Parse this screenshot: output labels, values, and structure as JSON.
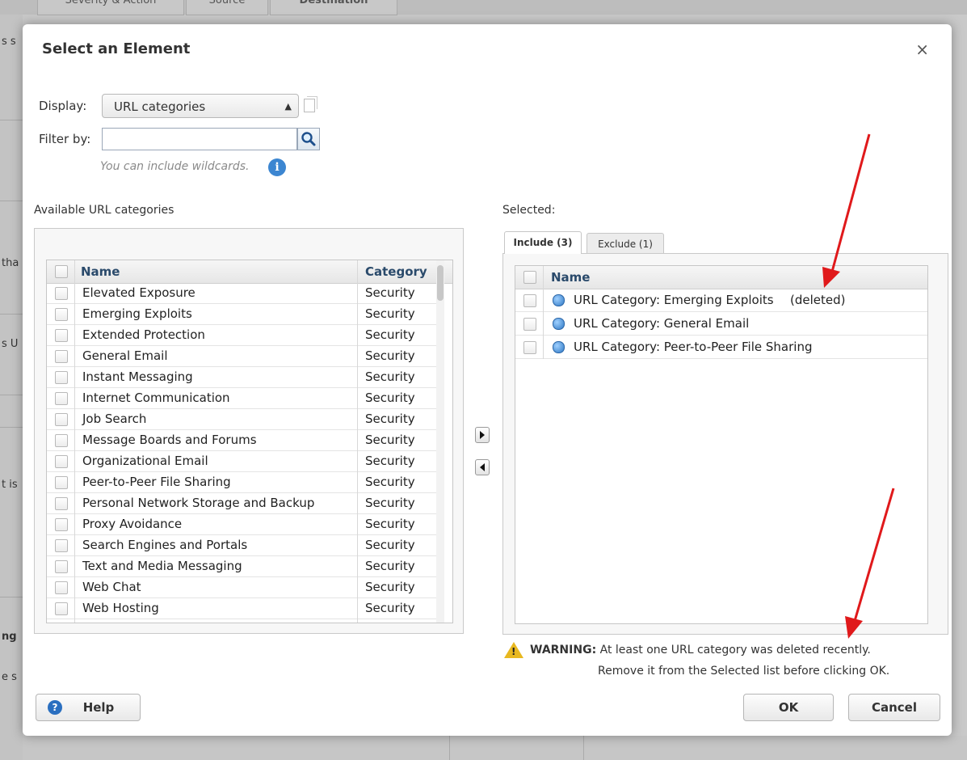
{
  "background": {
    "tabs": [
      "Severity & Action",
      "Source",
      "Destination"
    ],
    "left_fragments": [
      "s s",
      "tha",
      "s U",
      "t is",
      "ng",
      "e s"
    ]
  },
  "dialog": {
    "title": "Select an Element",
    "close_label": "×",
    "display_label": "Display:",
    "display_value": "URL categories",
    "filter_label": "Filter by:",
    "filter_value": "",
    "filter_placeholder": "",
    "hint": "You can include wildcards.",
    "available_heading": "Available URL categories",
    "selected_heading": "Selected:",
    "available_columns": {
      "name": "Name",
      "category": "Category"
    },
    "available_rows": [
      {
        "name": "Elevated Exposure",
        "category": "Security"
      },
      {
        "name": "Emerging Exploits",
        "category": "Security"
      },
      {
        "name": "Extended Protection",
        "category": "Security"
      },
      {
        "name": "General Email",
        "category": "Security"
      },
      {
        "name": "Instant Messaging",
        "category": "Security"
      },
      {
        "name": "Internet Communication",
        "category": "Security"
      },
      {
        "name": "Job Search",
        "category": "Security"
      },
      {
        "name": "Message Boards and Forums",
        "category": "Security"
      },
      {
        "name": "Organizational Email",
        "category": "Security"
      },
      {
        "name": "Peer-to-Peer File Sharing",
        "category": "Security"
      },
      {
        "name": "Personal Network Storage and Backup",
        "category": "Security"
      },
      {
        "name": "Proxy Avoidance",
        "category": "Security"
      },
      {
        "name": "Search Engines and Portals",
        "category": "Security"
      },
      {
        "name": "Text and Media Messaging",
        "category": "Security"
      },
      {
        "name": "Web Chat",
        "category": "Security"
      },
      {
        "name": "Web Hosting",
        "category": "Security"
      }
    ],
    "tabs": {
      "include": "Include (3)",
      "exclude": "Exclude (1)"
    },
    "selected_columns": {
      "name": "Name"
    },
    "selected_rows": [
      {
        "name": "URL Category: Emerging Exploits",
        "note": "(deleted)"
      },
      {
        "name": "URL Category: General Email",
        "note": ""
      },
      {
        "name": "URL Category: Peer-to-Peer File Sharing",
        "note": ""
      }
    ],
    "warning_label": "WARNING:",
    "warning_line1": "At least one URL category was deleted recently.",
    "warning_line2": "Remove it from the Selected list before clicking OK.",
    "help_label": "Help",
    "ok_label": "OK",
    "cancel_label": "Cancel"
  },
  "colors": {
    "annotation_arrow": "#e0191b",
    "warning": "#e8b820",
    "header_text": "#2a4a6b"
  },
  "icons": [
    "copy-icon",
    "search-icon",
    "info-icon",
    "globe-icon",
    "warning-icon",
    "help-icon",
    "move-right-icon",
    "move-left-icon"
  ]
}
